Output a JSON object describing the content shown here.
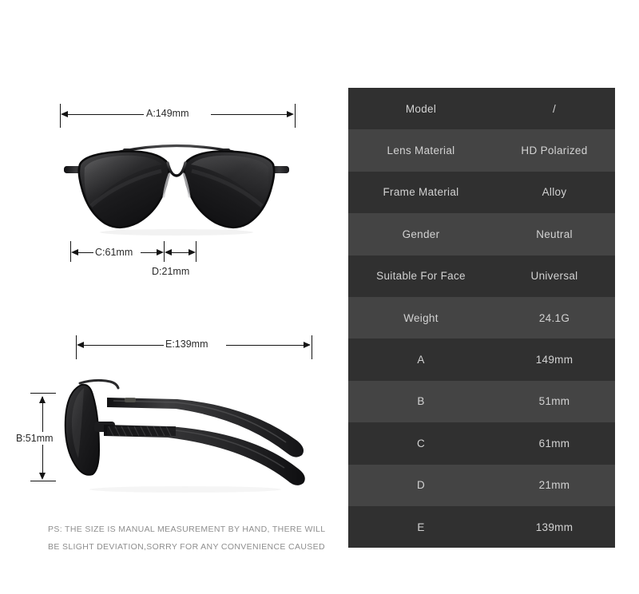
{
  "product": {
    "type": "sunglasses",
    "view_front_label": "front-view",
    "view_side_label": "side-view"
  },
  "diagram": {
    "front": {
      "width_dim": {
        "label": "A:149mm",
        "letter": "A",
        "value": "149mm"
      },
      "lens_dim": {
        "label": "C:61mm",
        "letter": "C",
        "value": "61mm"
      },
      "bridge_dim": {
        "label": "D:21mm",
        "letter": "D",
        "value": "21mm"
      }
    },
    "side": {
      "temple_dim": {
        "label": "E:139mm",
        "letter": "E",
        "value": "139mm"
      },
      "height_dim": {
        "label": "B:51mm",
        "letter": "B",
        "value": "51mm"
      }
    }
  },
  "disclaimer": {
    "line1": "PS: THE SIZE IS MANUAL MEASUREMENT BY HAND, THERE WILL",
    "line2": "BE SLIGHT DEVIATION,SORRY FOR ANY CONVENIENCE CAUSED"
  },
  "spec_table": {
    "rows": [
      {
        "key": "Model",
        "value": "/"
      },
      {
        "key": "Lens Material",
        "value": "HD Polarized"
      },
      {
        "key": "Frame Material",
        "value": "Alloy"
      },
      {
        "key": "Gender",
        "value": "Neutral"
      },
      {
        "key": "Suitable For Face",
        "value": "Universal"
      },
      {
        "key": "Weight",
        "value": "24.1G"
      },
      {
        "key": "A",
        "value": "149mm"
      },
      {
        "key": "B",
        "value": "51mm"
      },
      {
        "key": "C",
        "value": "61mm"
      },
      {
        "key": "D",
        "value": "21mm"
      },
      {
        "key": "E",
        "value": "139mm"
      }
    ]
  },
  "colors": {
    "row_dark": "#303030",
    "row_light": "#444444",
    "table_text": "#d2d2d2",
    "dimension_line": "#141414",
    "dimension_text": "#2b2b2b",
    "disclaimer_text": "#8e8e8e",
    "background": "#ffffff"
  }
}
